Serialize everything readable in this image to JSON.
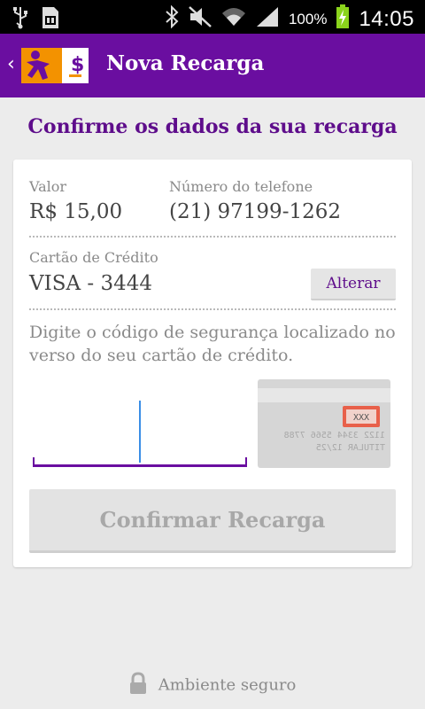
{
  "status_bar": {
    "battery_percent": "100%",
    "time": "14:05",
    "icons": [
      "usb-icon",
      "sd-card-icon",
      "bluetooth-icon",
      "mute-icon",
      "wifi-icon",
      "signal-icon",
      "battery-charging-icon"
    ]
  },
  "action_bar": {
    "title": "Nova Recarga",
    "back_icon": "chevron-left-icon",
    "color": "#6a0ea0"
  },
  "page": {
    "heading": "Confirme os dados da sua recarga"
  },
  "recharge": {
    "value_label": "Valor",
    "value": "R$ 15,00",
    "phone_label": "Número do telefone",
    "phone": "(21) 97199-1262",
    "card_label": "Cartão de Crédito",
    "card": "VISA - 3444",
    "change_button": "Alterar"
  },
  "security": {
    "instructions": "Digite o código de segurança localizado no verso do seu cartão de crédito.",
    "cvv_value": "",
    "card_illustration": {
      "cvv_placeholder": "XXX",
      "number_fragment": "1122 3344 5566 7788",
      "holder_fragment": "TITULAR 12/25"
    }
  },
  "confirm_button": "Confirmar Recarga",
  "footer": {
    "text": "Ambiente seguro",
    "icon": "lock-icon"
  },
  "colors": {
    "brand_purple": "#6a0ea0",
    "heading_purple": "#5e0d8b",
    "accent_orange": "#f39200",
    "cvv_highlight": "#e8604a",
    "battery_green": "#8bd41c"
  }
}
